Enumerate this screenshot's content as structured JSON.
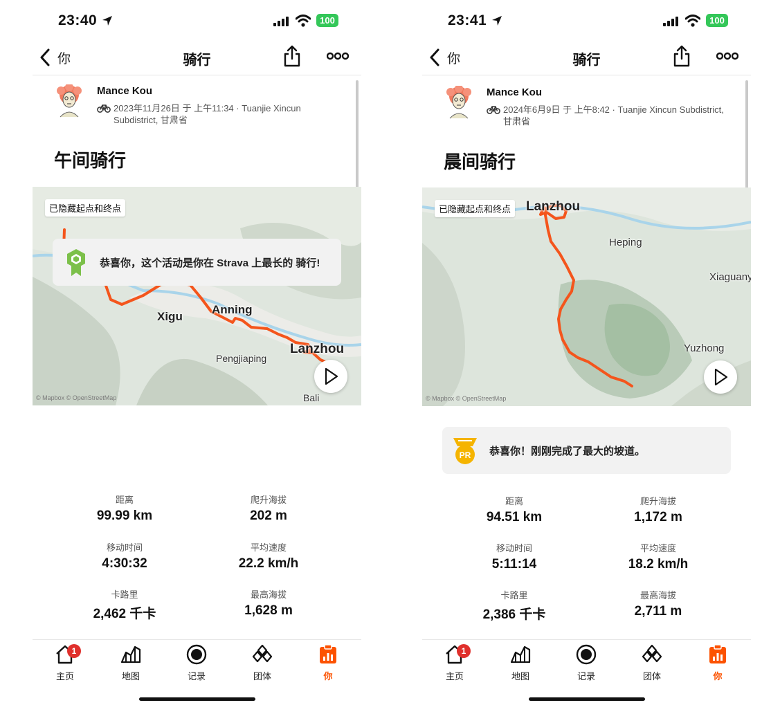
{
  "colors": {
    "accent": "#fc5200",
    "route": "#f4551c",
    "badge_red": "#e0302c",
    "battery_green": "#34c759",
    "achievement_bg": "#f2f2f2"
  },
  "phones": [
    {
      "status": {
        "time": "23:40",
        "battery": "100"
      },
      "nav": {
        "back_label": "你",
        "title": "骑行",
        "share_icon": "share-icon",
        "more_icon": "more-icon"
      },
      "athlete": {
        "name": "Mance Kou",
        "meta": "2023年11月26日 于 上午11:34 · Tuanjie Xincun Subdistrict, 甘肃省"
      },
      "activity_title": "午间骑行",
      "map": {
        "hidden_notice": "已隐藏起点和终点",
        "labels": {
          "xigu": "Xigu",
          "anning": "Anning",
          "lanzhou": "Lanzhou",
          "pengjiaping": "Pengjiaping",
          "bali": "Bali"
        },
        "attribution": "© Mapbox © OpenStreetMap"
      },
      "achievement": {
        "icon": "longest-ride-icon",
        "text": "恭喜你，这个活动是你在 Strava 上最长的 骑行!"
      },
      "stats": [
        {
          "label": "距离",
          "value": "99.99 km"
        },
        {
          "label": "爬升海拔",
          "value": "202 m"
        },
        {
          "label": "移动时间",
          "value": "4:30:32"
        },
        {
          "label": "平均速度",
          "value": "22.2 km/h"
        },
        {
          "label": "卡路里",
          "value": "2,462 千卡"
        },
        {
          "label": "最高海拔",
          "value": "1,628 m"
        }
      ],
      "tabs": [
        {
          "label": "主页",
          "badge": "1"
        },
        {
          "label": "地图"
        },
        {
          "label": "记录"
        },
        {
          "label": "团体"
        },
        {
          "label": "你"
        }
      ]
    },
    {
      "status": {
        "time": "23:41",
        "battery": "100"
      },
      "nav": {
        "back_label": "你",
        "title": "骑行",
        "share_icon": "share-icon",
        "more_icon": "more-icon"
      },
      "athlete": {
        "name": "Mance Kou",
        "meta": "2024年6月9日 于 上午8:42 · Tuanjie Xincun Subdistrict, 甘肃省"
      },
      "activity_title": "晨间骑行",
      "map": {
        "hidden_notice": "已隐藏起点和终点",
        "labels": {
          "lanzhou": "Lanzhou",
          "heping": "Heping",
          "xiaguanying": "Xiaguany",
          "yuzhong": "Yuzhong"
        },
        "attribution": "© Mapbox © OpenStreetMap"
      },
      "achievement": {
        "icon": "pr-medal-icon",
        "text": "恭喜你！刚刚完成了最大的坡道。"
      },
      "stats": [
        {
          "label": "距离",
          "value": "94.51 km"
        },
        {
          "label": "爬升海拔",
          "value": "1,172 m"
        },
        {
          "label": "移动时间",
          "value": "5:11:14"
        },
        {
          "label": "平均速度",
          "value": "18.2 km/h"
        },
        {
          "label": "卡路里",
          "value": "2,386 千卡"
        },
        {
          "label": "最高海拔",
          "value": "2,711 m"
        }
      ],
      "tabs": [
        {
          "label": "主页",
          "badge": "1"
        },
        {
          "label": "地图"
        },
        {
          "label": "记录"
        },
        {
          "label": "团体"
        },
        {
          "label": "你"
        }
      ]
    }
  ]
}
